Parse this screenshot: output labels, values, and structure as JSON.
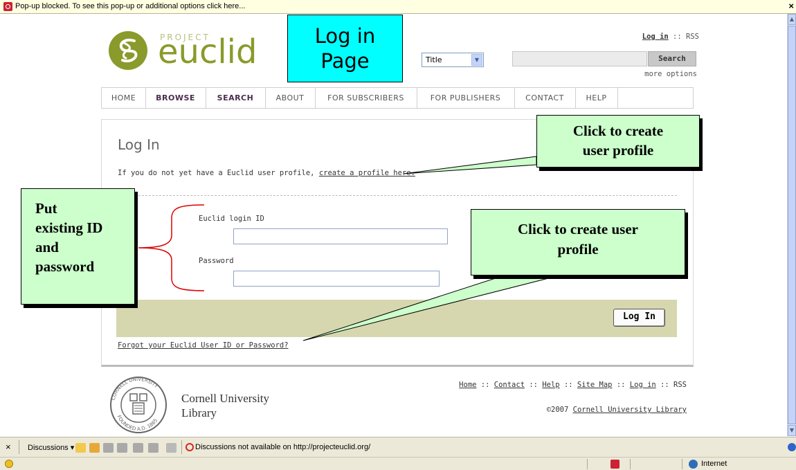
{
  "browser": {
    "popup_text": "Pop-up blocked. To see this pop-up or additional options click here...",
    "close_glyph": "×",
    "discussions_label": "Discussions ▾",
    "discussions_status": "Discussions not available on http://projecteuclid.org/",
    "zone_label": "Internet"
  },
  "header": {
    "logo_small": "PROJECT",
    "logo_big": "euclid",
    "login_link": "Log in",
    "sep": "::",
    "rss_link": "RSS",
    "search_select_value": "Title",
    "search_button": "Search",
    "more_options": "more options"
  },
  "nav": [
    "HOME",
    "BROWSE",
    "SEARCH",
    "ABOUT",
    "FOR SUBSCRIBERS",
    "FOR PUBLISHERS",
    "CONTACT",
    "HELP"
  ],
  "main": {
    "title": "Log In",
    "intro_text": "If you do not yet have a Euclid user profile,",
    "intro_link": "create a profile here.",
    "login_id_label": "Euclid login ID",
    "password_label": "Password",
    "login_button": "Log In",
    "forgot_link": "Forgot your Euclid User ID or Password?"
  },
  "footer": {
    "links": [
      "Home",
      "Contact",
      "Help",
      "Site Map",
      "Log in",
      "RSS"
    ],
    "sep": " :: ",
    "copyright": "©2007",
    "copyright_link": "Cornell University Library",
    "institution_line1": "Cornell University",
    "institution_line2": "Library",
    "seal_top": "CORNELL UNIVERSITY",
    "seal_bottom": "FOUNDED A.D. 1865"
  },
  "annotations": {
    "title_line1": "Log in",
    "title_line2": "Page",
    "top_callout_line1": "Click to create",
    "top_callout_line2": "user profile",
    "mid_callout_line1": "Click to create user",
    "mid_callout_line2": "profile",
    "left_callout_lines": [
      "Put",
      "existing ID",
      "and",
      "password"
    ]
  },
  "colors": {
    "callout_fill": "#ccffcc",
    "title_box_fill": "#00ffff",
    "logo_green": "#8a9a2b",
    "login_band": "#d6d7ae",
    "nav_bold": "#4a2d4d",
    "bracket_red": "#dd0000"
  }
}
